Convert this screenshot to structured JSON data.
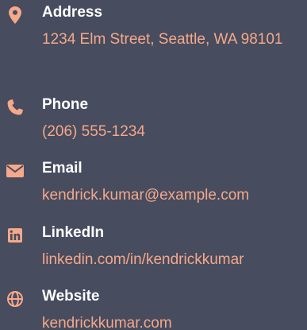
{
  "colors": {
    "background": "#474c5e",
    "icon": "#f5a88a",
    "label": "#ffffff",
    "value": "#f5a88a"
  },
  "contact": {
    "items": [
      {
        "icon": "map-pin-icon",
        "label": "Address",
        "value": "1234 Elm Street, Seattle, WA 98101"
      },
      {
        "icon": "phone-icon",
        "label": "Phone",
        "value": "(206) 555-1234"
      },
      {
        "icon": "envelope-icon",
        "label": "Email",
        "value": "kendrick.kumar@example.com"
      },
      {
        "icon": "linkedin-icon",
        "label": "LinkedIn",
        "value": "linkedin.com/in/kendrickkumar"
      },
      {
        "icon": "globe-icon",
        "label": "Website",
        "value": "kendrickkumar.com"
      }
    ]
  }
}
